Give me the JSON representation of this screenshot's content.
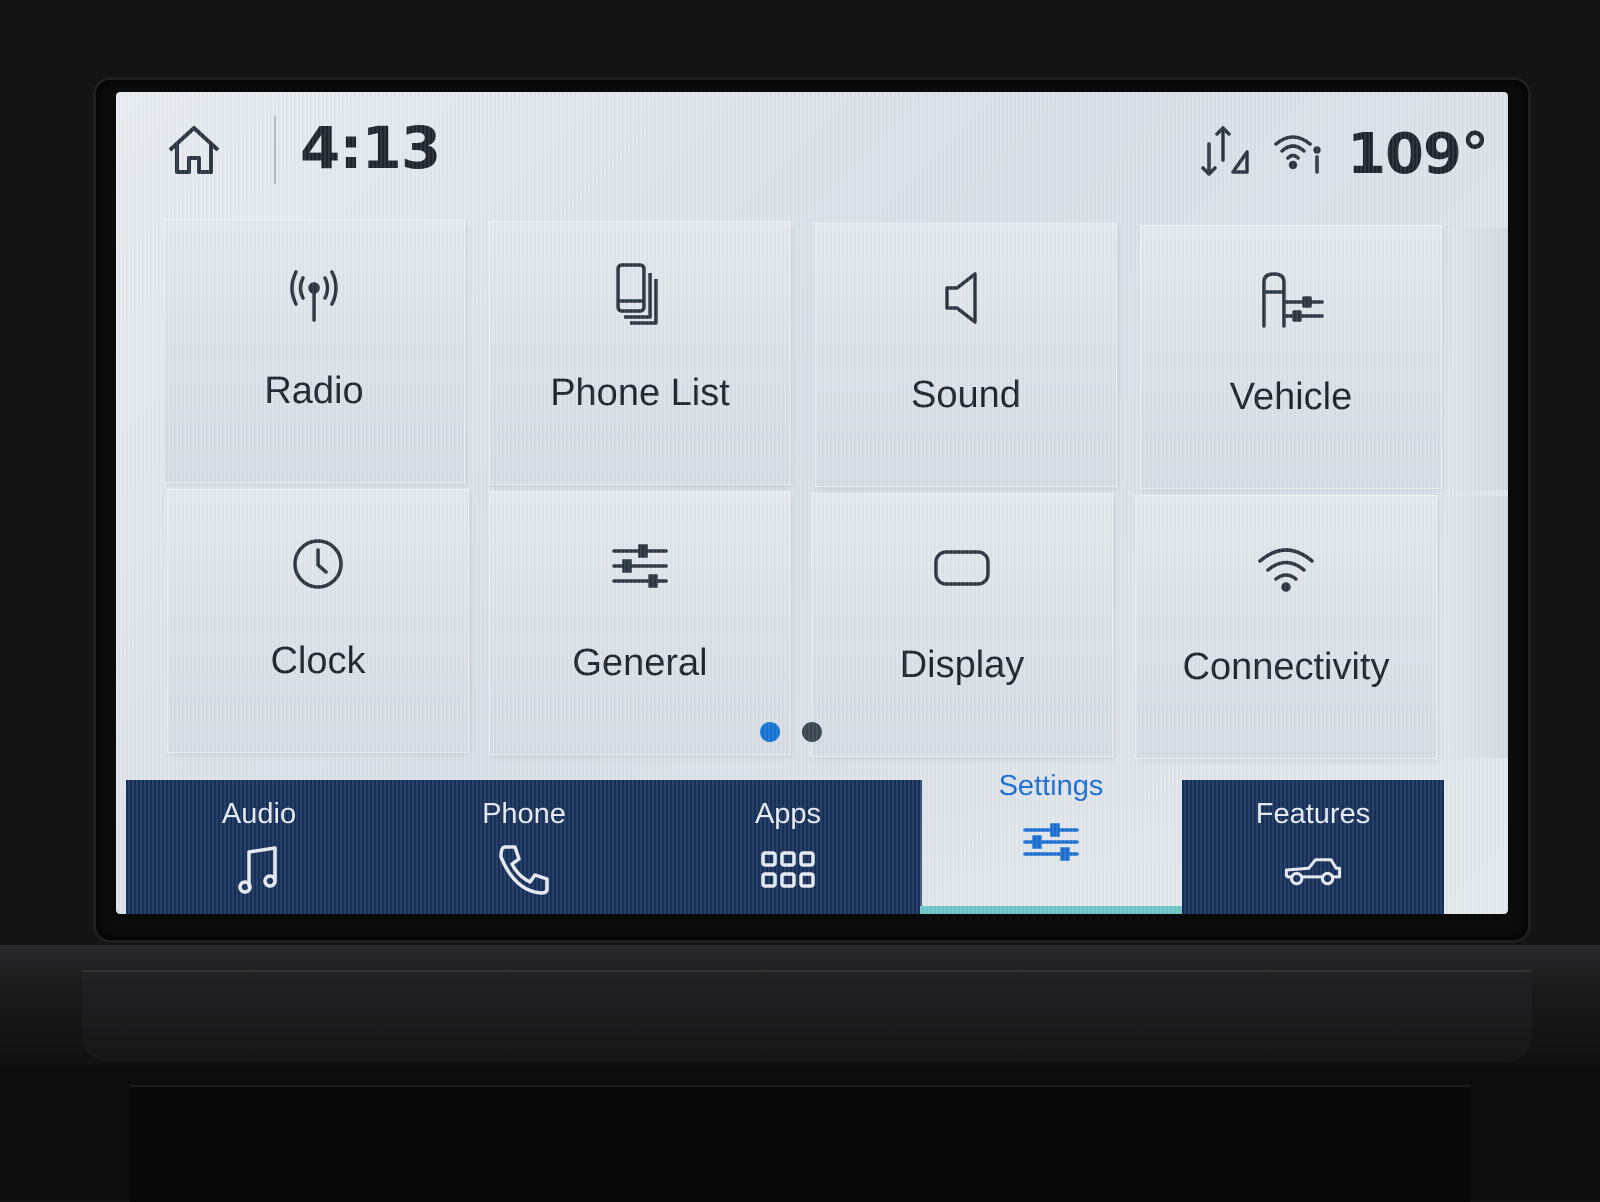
{
  "status_bar": {
    "time": "4:13",
    "temperature": "109°",
    "icons": [
      "home-icon",
      "data-arrows-icon",
      "wifi-info-icon"
    ]
  },
  "tiles": [
    {
      "label": "Radio",
      "icon": "radio-antenna-icon"
    },
    {
      "label": "Phone List",
      "icon": "phone-list-icon"
    },
    {
      "label": "Sound",
      "icon": "speaker-icon"
    },
    {
      "label": "Vehicle",
      "icon": "vehicle-settings-icon"
    },
    {
      "label": "Clock",
      "icon": "clock-icon"
    },
    {
      "label": "General",
      "icon": "sliders-icon"
    },
    {
      "label": "Display",
      "icon": "display-icon"
    },
    {
      "label": "Connectivity",
      "icon": "wifi-icon"
    }
  ],
  "pagination": {
    "pages": 2,
    "active": 1
  },
  "nav": [
    {
      "label": "Audio",
      "icon": "music-note-icon"
    },
    {
      "label": "Phone",
      "icon": "phone-handset-icon"
    },
    {
      "label": "Apps",
      "icon": "apps-grid-icon"
    },
    {
      "label": "Settings",
      "icon": "settings-sliders-icon",
      "active": true
    },
    {
      "label": "Features",
      "icon": "truck-icon"
    }
  ],
  "colors": {
    "nav_bg": "#17305a",
    "accent": "#1a6fd1",
    "screen_bg": "#e2e7ec",
    "text": "#1e252d",
    "active_indicator": "#6fc6c8"
  }
}
